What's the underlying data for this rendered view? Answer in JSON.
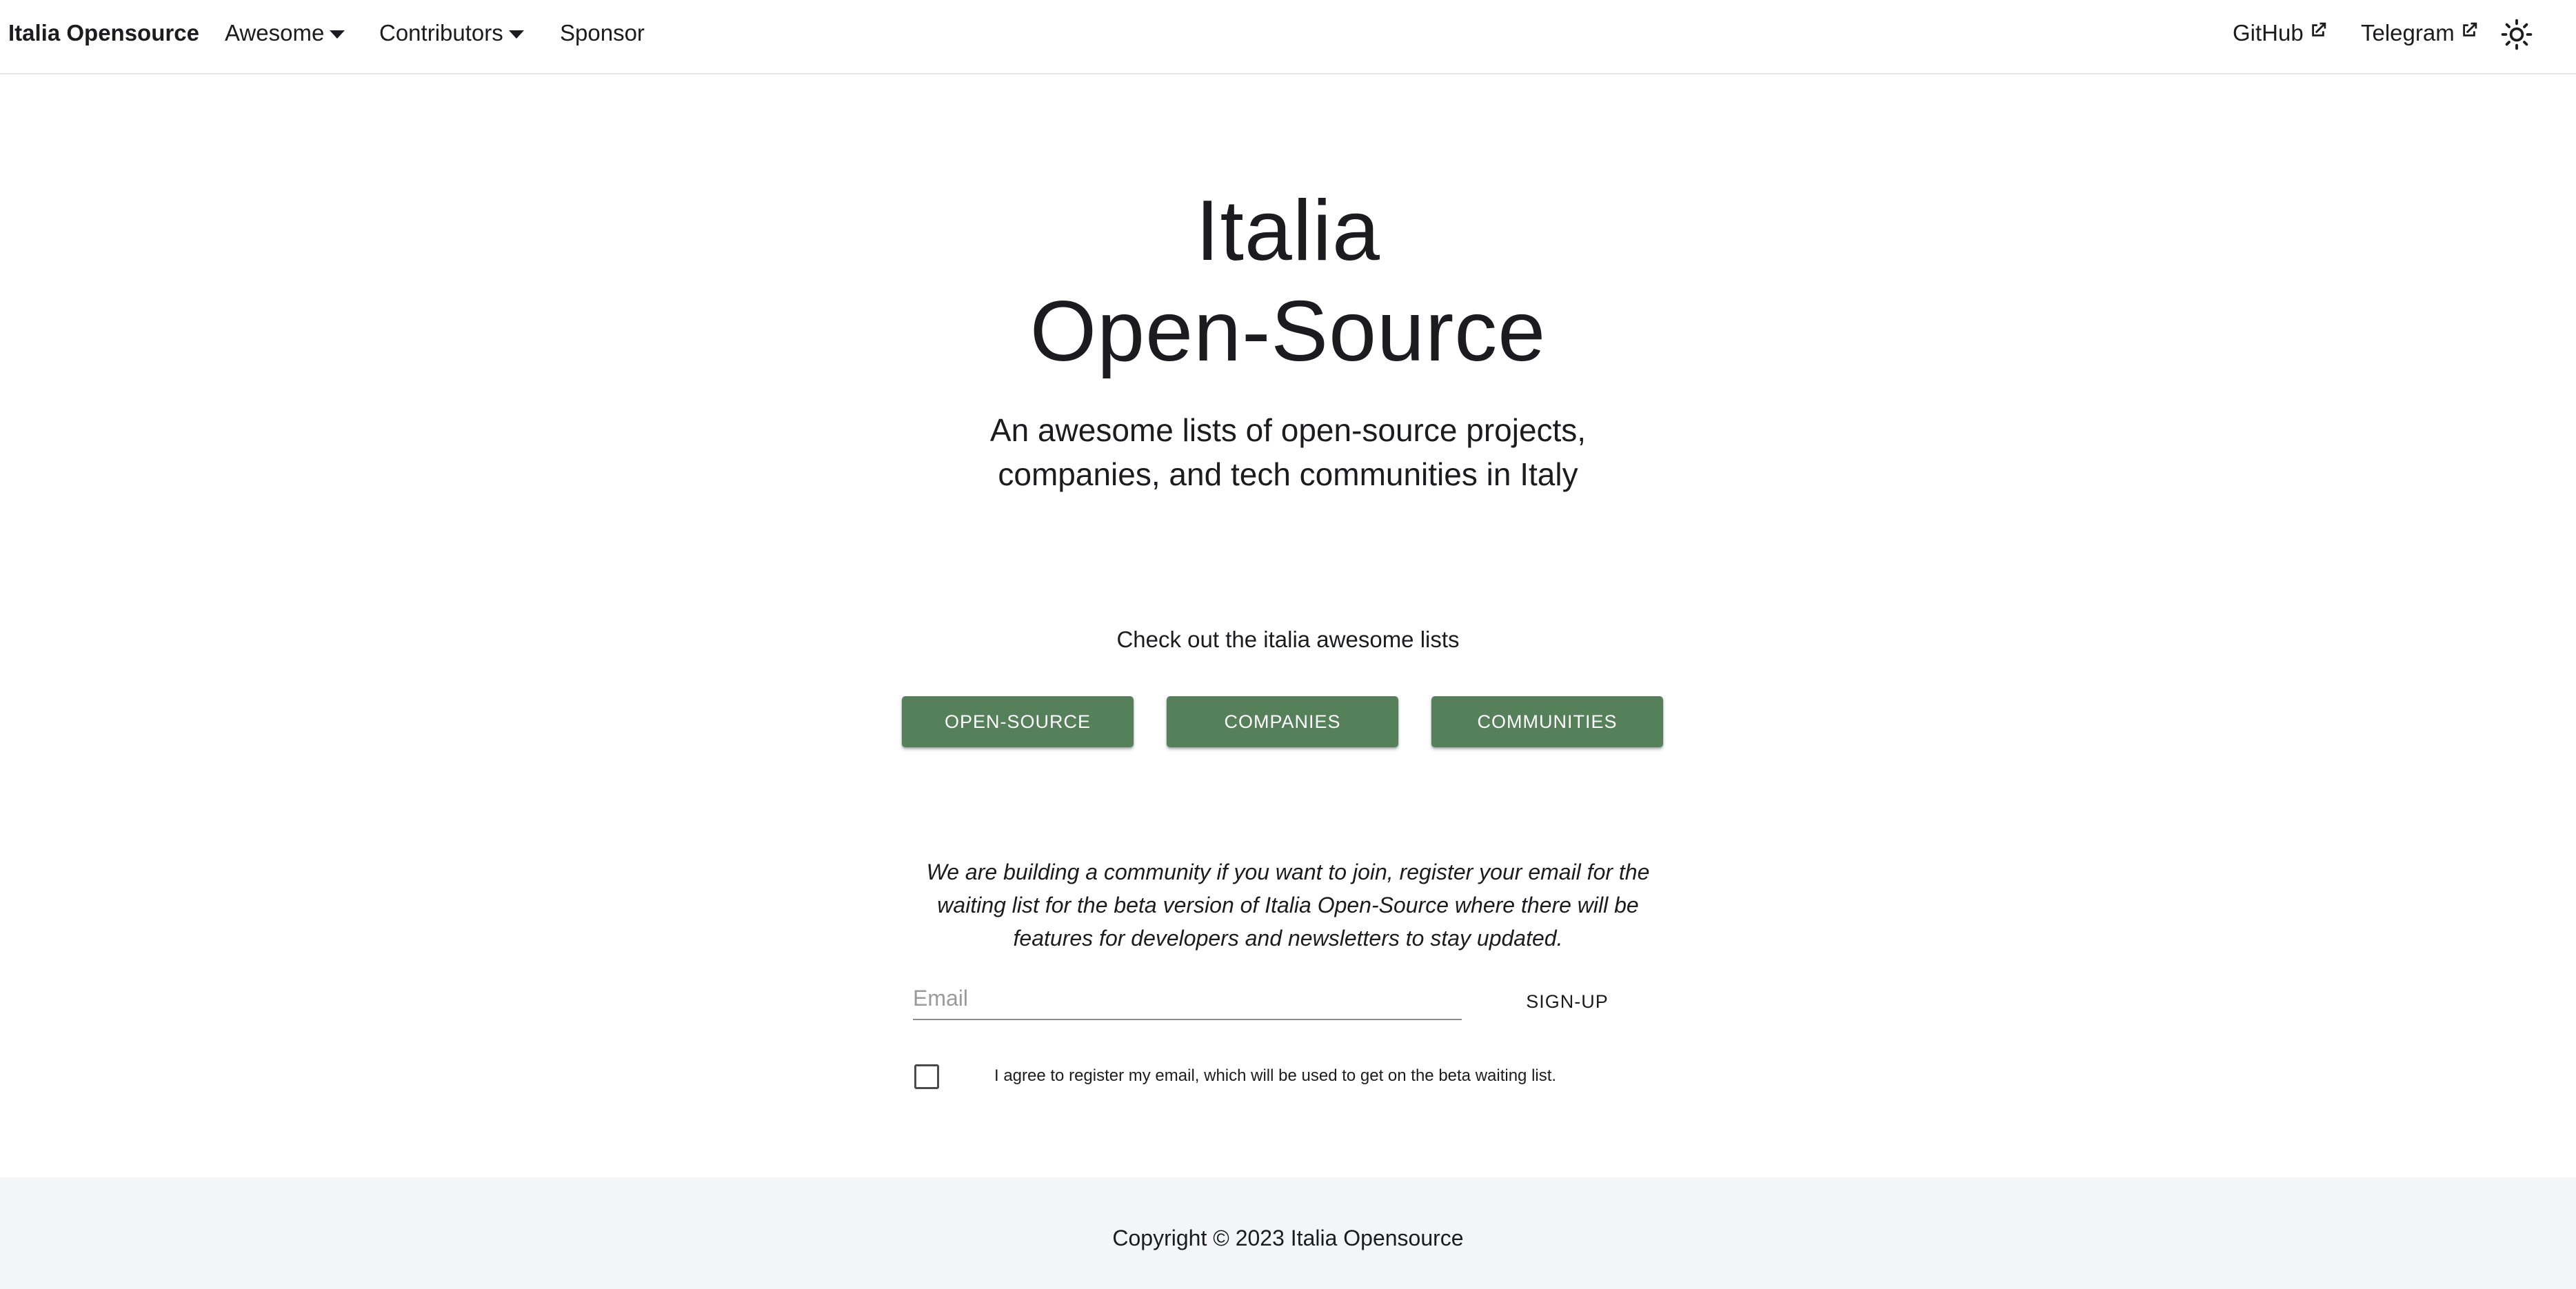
{
  "navbar": {
    "brand": "Italia Opensource",
    "items": [
      {
        "label": "Awesome",
        "dropdown": true
      },
      {
        "label": "Contributors",
        "dropdown": true
      },
      {
        "label": "Sponsor",
        "dropdown": false
      }
    ],
    "external_links": [
      {
        "label": "GitHub",
        "icon": "external-link-icon"
      },
      {
        "label": "Telegram",
        "icon": "external-link-icon"
      }
    ],
    "theme_toggle_icon": "sun-icon"
  },
  "hero": {
    "title_line1": "Italia",
    "title_line2": "Open-Source",
    "subtitle": "An awesome lists of open-source projects, companies, and tech communities in Italy"
  },
  "lists": {
    "label": "Check out the italia awesome lists",
    "buttons": [
      "OPEN-SOURCE",
      "COMPANIES",
      "COMMUNITIES"
    ]
  },
  "signup": {
    "text": "We are building a community if you want to join, register your email for the waiting list for the beta version of Italia Open-Source where there will be features for developers and newsletters to stay updated.",
    "email_placeholder": "Email",
    "email_value": "",
    "button": "SIGN-UP",
    "agree_checked": false,
    "agree_label": "I agree to register my email, which will be used to get on the beta waiting list."
  },
  "footer": {
    "copyright": "Copyright © 2023 Italia Opensource"
  },
  "colors": {
    "accent": "#55805a",
    "footer_bg": "#f4f5f7",
    "text": "#1c1b1f"
  }
}
